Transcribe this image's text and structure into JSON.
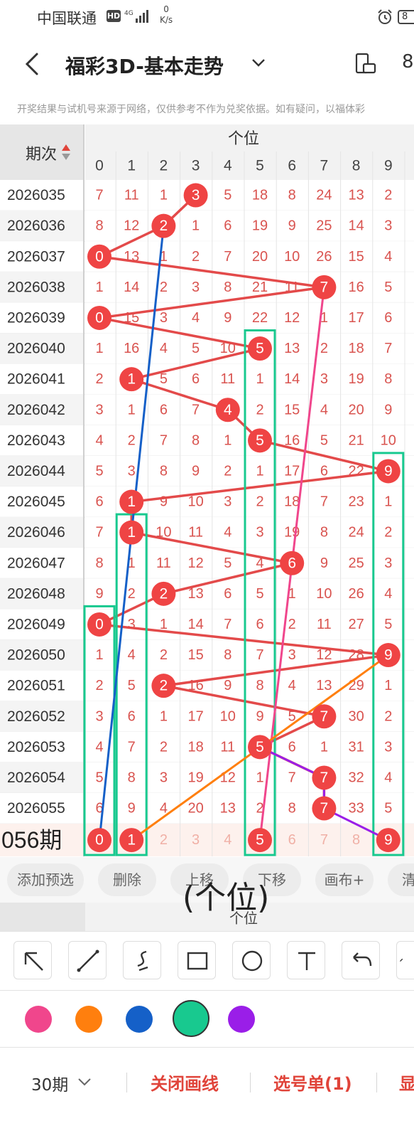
{
  "status_bar": {
    "carrier": "中国联通",
    "hd": "HD",
    "network": "4G",
    "speed_value": "0",
    "speed_unit": "K/s",
    "battery": "8"
  },
  "header": {
    "title": "福彩3D-基本走势",
    "partial_icon_text": "8"
  },
  "disclaimer": "开奖结果与试机号来源于网络，仅供参考不作为兑奖依据。如有疑问，以福体彩",
  "table": {
    "period_header": "期次",
    "group_header": "个位",
    "digits": [
      "0",
      "1",
      "2",
      "3",
      "4",
      "5",
      "6",
      "7",
      "8",
      "9"
    ],
    "rows": [
      {
        "period": "2026035",
        "hit": 3,
        "cells": [
          "7",
          "11",
          "1",
          "3",
          "5",
          "18",
          "8",
          "24",
          "13",
          "2"
        ]
      },
      {
        "period": "2026036",
        "hit": 2,
        "cells": [
          "8",
          "12",
          "2",
          "1",
          "6",
          "19",
          "9",
          "25",
          "14",
          "3"
        ]
      },
      {
        "period": "2026037",
        "hit": 0,
        "cells": [
          "0",
          "13",
          "1",
          "2",
          "7",
          "20",
          "10",
          "26",
          "15",
          "4"
        ]
      },
      {
        "period": "2026038",
        "hit": 7,
        "cells": [
          "1",
          "14",
          "2",
          "3",
          "8",
          "21",
          "11",
          "7",
          "16",
          "5"
        ]
      },
      {
        "period": "2026039",
        "hit": 0,
        "cells": [
          "0",
          "15",
          "3",
          "4",
          "9",
          "22",
          "12",
          "1",
          "17",
          "6"
        ]
      },
      {
        "period": "2026040",
        "hit": 5,
        "cells": [
          "1",
          "16",
          "4",
          "5",
          "10",
          "5",
          "13",
          "2",
          "18",
          "7"
        ]
      },
      {
        "period": "2026041",
        "hit": 1,
        "cells": [
          "2",
          "1",
          "5",
          "6",
          "11",
          "1",
          "14",
          "3",
          "19",
          "8"
        ]
      },
      {
        "period": "2026042",
        "hit": 4,
        "cells": [
          "3",
          "1",
          "6",
          "7",
          "4",
          "2",
          "15",
          "4",
          "20",
          "9"
        ]
      },
      {
        "period": "2026043",
        "hit": 5,
        "cells": [
          "4",
          "2",
          "7",
          "8",
          "1",
          "5",
          "16",
          "5",
          "21",
          "10"
        ]
      },
      {
        "period": "2026044",
        "hit": 9,
        "cells": [
          "5",
          "3",
          "8",
          "9",
          "2",
          "1",
          "17",
          "6",
          "22",
          "9"
        ]
      },
      {
        "period": "2026045",
        "hit": 1,
        "cells": [
          "6",
          "1",
          "9",
          "10",
          "3",
          "2",
          "18",
          "7",
          "23",
          "1"
        ]
      },
      {
        "period": "2026046",
        "hit": 1,
        "cells": [
          "7",
          "1",
          "10",
          "11",
          "4",
          "3",
          "19",
          "8",
          "24",
          "2"
        ]
      },
      {
        "period": "2026047",
        "hit": 6,
        "cells": [
          "8",
          "1",
          "11",
          "12",
          "5",
          "4",
          "6",
          "9",
          "25",
          "3"
        ]
      },
      {
        "period": "2026048",
        "hit": 2,
        "cells": [
          "9",
          "2",
          "2",
          "13",
          "6",
          "5",
          "1",
          "10",
          "26",
          "4"
        ]
      },
      {
        "period": "2026049",
        "hit": 0,
        "cells": [
          "0",
          "3",
          "1",
          "14",
          "7",
          "6",
          "2",
          "11",
          "27",
          "5"
        ]
      },
      {
        "period": "2026050",
        "hit": 9,
        "cells": [
          "1",
          "4",
          "2",
          "15",
          "8",
          "7",
          "3",
          "12",
          "28",
          "9"
        ]
      },
      {
        "period": "2026051",
        "hit": 2,
        "cells": [
          "2",
          "5",
          "2",
          "16",
          "9",
          "8",
          "4",
          "13",
          "29",
          "1"
        ]
      },
      {
        "period": "2026052",
        "hit": 7,
        "cells": [
          "3",
          "6",
          "1",
          "17",
          "10",
          "9",
          "5",
          "7",
          "30",
          "2"
        ]
      },
      {
        "period": "2026053",
        "hit": 5,
        "cells": [
          "4",
          "7",
          "2",
          "18",
          "11",
          "5",
          "6",
          "1",
          "31",
          "3"
        ]
      },
      {
        "period": "2026054",
        "hit": 7,
        "cells": [
          "5",
          "8",
          "3",
          "19",
          "12",
          "1",
          "7",
          "7",
          "32",
          "4"
        ]
      },
      {
        "period": "2026055",
        "hit": 7,
        "cells": [
          "6",
          "9",
          "4",
          "20",
          "13",
          "2",
          "8",
          "7",
          "33",
          "5"
        ]
      }
    ],
    "preview_row": {
      "label": "056期",
      "selected": [
        0,
        1,
        5,
        9
      ],
      "cells": [
        "0",
        "1",
        "2",
        "3",
        "4",
        "5",
        "6",
        "7",
        "8",
        "9"
      ]
    }
  },
  "actions": [
    "添加预选",
    "删除",
    "上移",
    "下移",
    "画布+",
    "清"
  ],
  "canvas_note": "(个位)",
  "sticky_header": "个位",
  "tools": [
    "arrow-tool",
    "line-tool",
    "curve-tool",
    "rectangle-tool",
    "circle-tool",
    "text-tool",
    "undo-tool",
    "redo-tool"
  ],
  "colors": {
    "pink": "#f0468c",
    "orange": "#ff7f0e",
    "blue": "#1560c8",
    "green": "#18c98f",
    "purple": "#9a1ee8",
    "hit_red": "#ef4444",
    "number_red": "#d9534f",
    "line_red": "#e34a4a"
  },
  "bottom_bar": {
    "periods": "30期",
    "close_draw": "关闭画线",
    "selection": "选号单(1)",
    "more": "显"
  }
}
